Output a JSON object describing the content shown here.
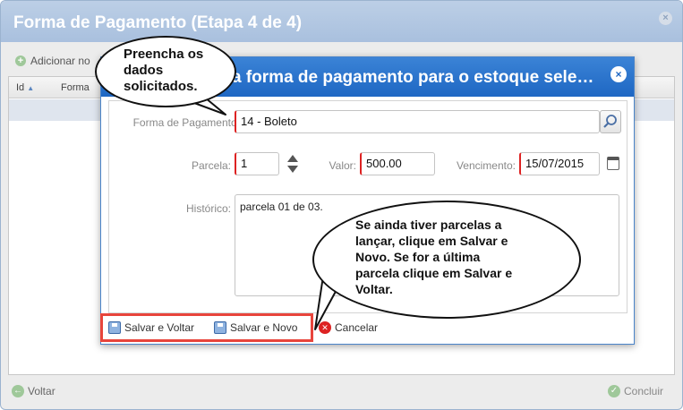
{
  "outer": {
    "title": "Forma de Pagamento (Etapa 4 de 4)",
    "add_button": "Adicionar no",
    "columns": [
      "Id",
      "Forma"
    ],
    "back_button": "Voltar",
    "finish_button": "Concluir"
  },
  "dialog": {
    "title": "a forma de pagamento para o estoque sele…",
    "payment_method_label": "Forma de Pagamento:",
    "payment_method_value": "14 - Boleto",
    "installment_label": "Parcela:",
    "installment_value": "1",
    "amount_label": "Valor:",
    "amount_value": "500.00",
    "due_label": "Vencimento:",
    "due_value": "15/07/2015",
    "history_label": "Histórico:",
    "history_value": "parcela 01 de 03.",
    "save_back_button": "Salvar e Voltar",
    "save_new_button": "Salvar e Novo",
    "cancel_button": "Cancelar"
  },
  "callouts": {
    "top": [
      "Preencha os",
      "dados",
      "solicitados."
    ],
    "bottom": [
      "Se ainda tiver parcelas a",
      "lançar, clique em Salvar e",
      "Novo. Se for a última",
      "parcela clique em Salvar e",
      "Voltar."
    ]
  },
  "colors": {
    "dialog_header": "#1e67c3",
    "required_border": "#dd2222",
    "highlight": "#e8453c"
  }
}
